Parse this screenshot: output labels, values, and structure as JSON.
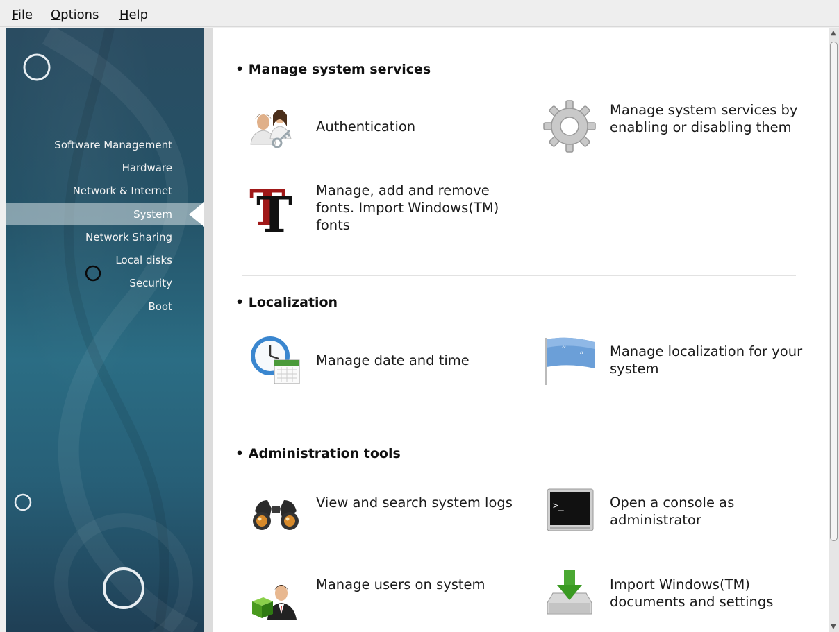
{
  "menubar": {
    "items": [
      {
        "accel": "F",
        "rest": "ile"
      },
      {
        "accel": "O",
        "rest": "ptions"
      },
      {
        "accel": "H",
        "rest": "elp"
      }
    ]
  },
  "sidebar": {
    "items": [
      {
        "label": "Software Management"
      },
      {
        "label": "Hardware"
      },
      {
        "label": "Network & Internet"
      },
      {
        "label": "System"
      },
      {
        "label": "Network Sharing"
      },
      {
        "label": "Local disks"
      },
      {
        "label": "Security"
      },
      {
        "label": "Boot"
      }
    ],
    "active": "System"
  },
  "sections": [
    {
      "title": "• Manage system services",
      "items": [
        {
          "label": "Authentication",
          "icon": "users-key-icon"
        },
        {
          "label": "Manage system services by enabling or disabling them",
          "icon": "gear-icon"
        },
        {
          "label": "Manage, add and remove fonts. Import Windows(TM) fonts",
          "icon": "font-icon"
        }
      ]
    },
    {
      "title": "• Localization",
      "items": [
        {
          "label": "Manage date and time",
          "icon": "clock-calendar-icon"
        },
        {
          "label": "Manage localization for your system",
          "icon": "flag-icon"
        }
      ]
    },
    {
      "title": "• Administration tools",
      "items": [
        {
          "label": "View and search system logs",
          "icon": "binoculars-icon"
        },
        {
          "label": "Open a console as administrator",
          "icon": "terminal-icon"
        },
        {
          "label": "Manage users on system",
          "icon": "user-cube-icon"
        },
        {
          "label": "Import Windows(TM) documents and settings",
          "icon": "download-tray-icon"
        }
      ]
    }
  ],
  "colors": {
    "sidebar_bg": "#26566c",
    "content_bg": "#ffffff",
    "menubar_bg": "#eeeeee"
  }
}
